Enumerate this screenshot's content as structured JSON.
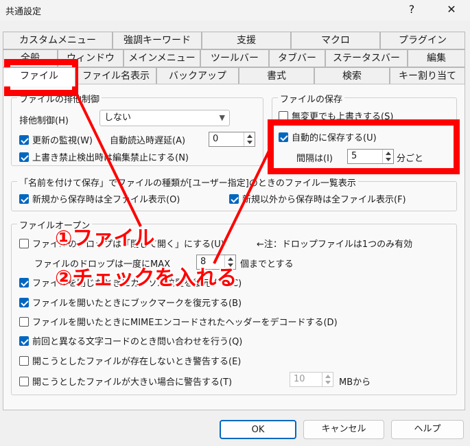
{
  "window": {
    "title": "共通設定",
    "help_label": "?",
    "close_label": "✕"
  },
  "tabs": {
    "row1": [
      "カスタムメニュー",
      "強調キーワード",
      "支援",
      "マクロ",
      "プラグイン"
    ],
    "row2": [
      "全般",
      "ウィンドウ",
      "メインメニュー",
      "ツールバー",
      "タブバー",
      "ステータスバー",
      "編集"
    ],
    "row3": [
      "ファイル",
      "ファイル名表示",
      "バックアップ",
      "書式",
      "検索",
      "キー割り当て"
    ]
  },
  "exclusive": {
    "title": "ファイルの排他制御",
    "label": "排他制御(H)",
    "select_value": "しない",
    "watch_label": "更新の監視(W)",
    "watch_checked": true,
    "delay_label": "自動読込時遅延(A)",
    "delay_value": "0",
    "lock_label": "上書き禁止検出時は編集禁止にする(N)",
    "lock_checked": true
  },
  "save": {
    "title": "ファイルの保存",
    "unchanged_label": "無変更でも上書きする(S)",
    "unchanged_checked": false,
    "autosave_label": "自動的に保存する(U)",
    "autosave_checked": true,
    "interval_label": "間隔は(I)",
    "interval_value": "5",
    "interval_unit": "分ごと"
  },
  "saveas": {
    "title": "「名前を付けて保存」でファイルの種類が[ユーザー指定]のときのファイル一覧表示",
    "new_label": "新規から保存時は全ファイル表示(O)",
    "new_checked": true,
    "other_label": "新規以外から保存時は全ファイル表示(F)",
    "other_checked": true
  },
  "open": {
    "title": "ファイルオープン",
    "drop_label": "ファイルのドロップは「閉じて開く」にする(U)",
    "drop_checked": false,
    "drop_note": "←注：ドロップファイルは1つのみ有効",
    "max_prefix": "ファイルのドロップは一度にMAX",
    "max_value": "8",
    "max_suffix": "個までとする",
    "cursor_label": "ファイルを閉じたときにカーソル位置を復元する(C)",
    "cursor_checked": true,
    "bookmark_label": "ファイルを開いたときにブックマークを復元する(B)",
    "bookmark_checked": true,
    "mime_label": "ファイルを開いたときにMIMEエンコードされたヘッダーをデコードする(D)",
    "mime_checked": false,
    "charcode_label": "前回と異なる文字コードのとき問い合わせを行う(Q)",
    "charcode_checked": true,
    "notexist_label": "開こうとしたファイルが存在しないとき警告する(E)",
    "notexist_checked": false,
    "large_label": "開こうとしたファイルが大きい場合に警告する(T)",
    "large_checked": false,
    "large_value": "10",
    "large_unit": "MBから"
  },
  "buttons": {
    "ok": "OK",
    "cancel": "キャンセル",
    "help": "ヘルプ"
  },
  "annotations": {
    "step1": "①ファイル",
    "step2": "②チェックを入れる",
    "color": "#ff0000"
  },
  "colors": {
    "accent": "#0067c0",
    "highlight": "#ff0000"
  }
}
